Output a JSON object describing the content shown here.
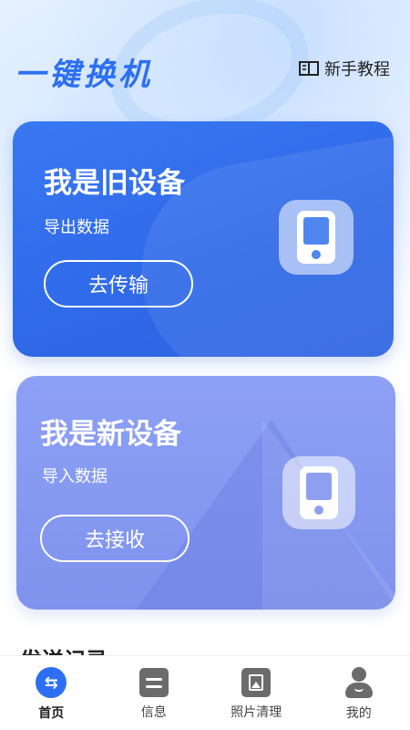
{
  "header": {
    "app_title": "一键换机",
    "tutorial_label": "新手教程"
  },
  "cards": {
    "old_device": {
      "title": "我是旧设备",
      "subtitle": "导出数据",
      "button_label": "去传输"
    },
    "new_device": {
      "title": "我是新设备",
      "subtitle": "导入数据",
      "button_label": "去接收"
    }
  },
  "section": {
    "title": "发送记录"
  },
  "tabbar": {
    "items": [
      {
        "label": "首页",
        "icon": "transfer-icon",
        "active": true
      },
      {
        "label": "信息",
        "icon": "message-icon",
        "active": false
      },
      {
        "label": "照片清理",
        "icon": "photo-icon",
        "active": false
      },
      {
        "label": "我的",
        "icon": "profile-icon",
        "active": false
      }
    ]
  },
  "colors": {
    "accent": "#2d6ff2",
    "old_card": "#3170ec",
    "new_card": "#8799f2"
  }
}
